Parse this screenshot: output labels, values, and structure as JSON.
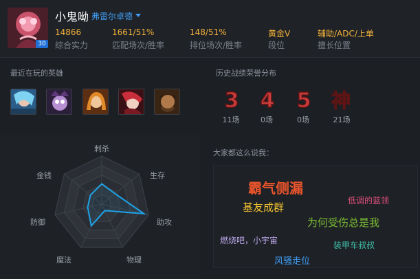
{
  "profile": {
    "name": "小鬼呦",
    "server": "弗雷尔卓德",
    "level": "30"
  },
  "stats": [
    {
      "value": "14866",
      "label": "综合实力"
    },
    {
      "value": "1661/51%",
      "label": "匹配场次/胜率"
    },
    {
      "value": "148/51%",
      "label": "排位场次/胜率"
    },
    {
      "value": "黄金Ⅴ",
      "label": "段位"
    },
    {
      "value": "辅助/ADC/上单",
      "label": "擅长位置"
    }
  ],
  "recent_heroes": {
    "title": "最近在玩的英雄",
    "heroes": [
      "hero-1",
      "hero-2",
      "hero-3",
      "hero-4",
      "hero-5"
    ]
  },
  "honor": {
    "title": "历史战绩荣誉分布",
    "items": [
      {
        "glyph": "3",
        "count": "11场",
        "color": "#d84a4a"
      },
      {
        "glyph": "4",
        "count": "0场",
        "color": "#d84a4a"
      },
      {
        "glyph": "5",
        "count": "0场",
        "color": "#d84a4a"
      },
      {
        "glyph": "神",
        "count": "21场",
        "color": "#e0403a"
      }
    ]
  },
  "radar": {
    "axes": [
      "刺杀",
      "生存",
      "助攻",
      "物理",
      "魔法",
      "防御",
      "金钱"
    ],
    "values": [
      0.42,
      0.35,
      0.9,
      0.15,
      0.5,
      0.3,
      0.3
    ]
  },
  "comments": {
    "title": "大家都这么说我：",
    "words": [
      {
        "text": "霸气侧漏",
        "color": "#e8542c"
      },
      {
        "text": "基友成群",
        "color": "#f2c230"
      },
      {
        "text": "低调的蓝领",
        "color": "#e0507a"
      },
      {
        "text": "为何受伤总是我",
        "color": "#7cbd32"
      },
      {
        "text": "燃烧吧，小宇宙",
        "color": "#b9a6e8"
      },
      {
        "text": "装甲车叔叔",
        "color": "#3fbfa8"
      },
      {
        "text": "风骚走位",
        "color": "#3f9cf2"
      }
    ]
  }
}
